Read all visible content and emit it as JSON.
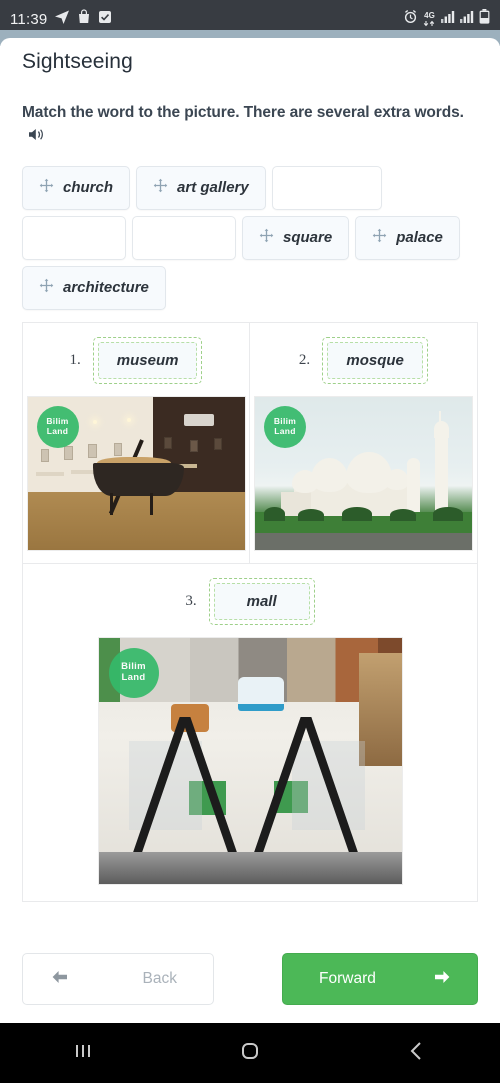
{
  "statusbar": {
    "time": "11:39",
    "left_icons": [
      "telegram-icon",
      "bag-icon",
      "checkbox-icon"
    ],
    "right_icons": [
      "alarm-icon",
      "network-4g-icon",
      "signal-bars-icon",
      "signal-bars-2-icon",
      "battery-icon"
    ],
    "network_label": "4G"
  },
  "page": {
    "title": "Sightseeing",
    "instruction": "Match the word to the picture. There are several extra words.",
    "audio_icon": "speaker-icon"
  },
  "wordbank": {
    "items": [
      {
        "label": "church",
        "empty": false
      },
      {
        "label": "art gallery",
        "empty": false
      },
      {
        "label": "",
        "empty": true
      },
      {
        "label": "",
        "empty": true
      },
      {
        "label": "",
        "empty": true
      },
      {
        "label": "square",
        "empty": false
      },
      {
        "label": "palace",
        "empty": false
      },
      {
        "label": "architecture",
        "empty": false
      }
    ],
    "drag_icon": "move-arrows-icon"
  },
  "tasks": [
    {
      "number": "1.",
      "answer": "museum",
      "image_alt": "museum-interior-boat-exhibit",
      "watermark": "BilimLand"
    },
    {
      "number": "2.",
      "answer": "mosque",
      "image_alt": "grand-mosque-white-domes",
      "watermark": "BilimLand"
    },
    {
      "number": "3.",
      "answer": "mall",
      "image_alt": "shopping-mall-escalators",
      "watermark": "BilimLand"
    }
  ],
  "watermark": {
    "line1": "Bilim",
    "line2": "Land"
  },
  "footer": {
    "back_label": "Back",
    "forward_label": "Forward",
    "back_icon": "arrow-left-icon",
    "forward_icon": "arrow-right-icon",
    "forward_color": "#4cb857"
  },
  "navbar": {
    "recents_icon": "recents-icon",
    "home_icon": "home-icon",
    "back_icon": "back-chevron-icon"
  }
}
